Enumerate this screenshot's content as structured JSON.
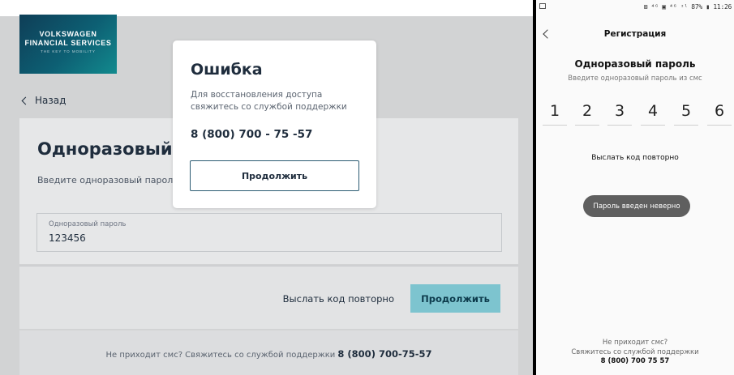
{
  "web": {
    "logo": {
      "line1": "VOLKSWAGEN",
      "line2": "FINANCIAL SERVICES",
      "tagline": "THE KEY TO MOBILITY"
    },
    "back_label": "Назад",
    "title": "Одноразовый пар",
    "subtitle": "Введите одноразовый пароль и",
    "field": {
      "label": "Одноразовый пароль",
      "value": "123456"
    },
    "resend_label": "Выслать код повторно",
    "continue_label": "Продолжить",
    "footer": {
      "text": "Не приходит смс? Свяжитесь со службой поддержки ",
      "phone": "8 (800) 700-75-57"
    }
  },
  "modal": {
    "title": "Ошибка",
    "message": "Для восстановления доступа свяжитесь со службой поддержки",
    "phone": "8 (800) 700 - 75 -57",
    "button_label": "Продолжить"
  },
  "phone": {
    "status_right": "⊠ ⁴ᴳ ▣ ⁴ᴳ ᶦˡ 87% ▮ 11:26",
    "nav_title": "Регистрация",
    "heading": "Одноразовый пароль",
    "hint": "Введите одноразовый пароль из смс",
    "digits": [
      "1",
      "2",
      "3",
      "4",
      "5",
      "6"
    ],
    "resend_label": "Выслать код повторно",
    "toast": "Пароль введен неверно",
    "footer": {
      "line1": "Не приходит смс?",
      "line2": "Свяжитесь со службой поддержки",
      "phone": "8 (800) 700 75 57"
    }
  },
  "colors": {
    "brand_dark": "#0e3e57",
    "accent": "#7dc4cf",
    "page_bg": "#d2d3d4"
  }
}
